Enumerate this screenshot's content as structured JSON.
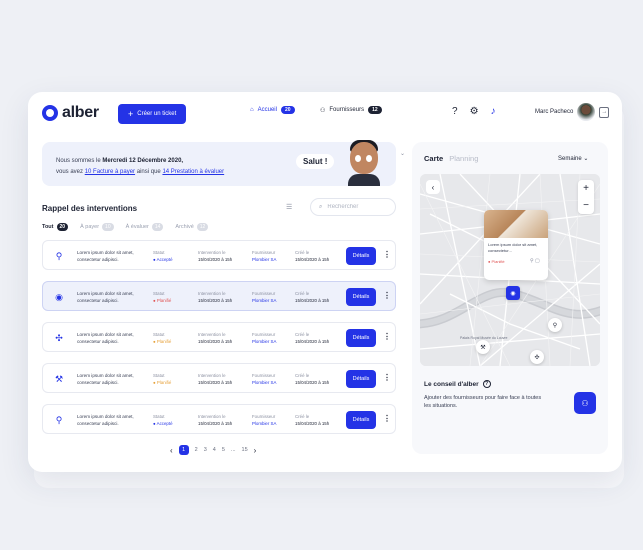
{
  "app": {
    "logo": "alber"
  },
  "header": {
    "create_button": "Créer un ticket",
    "nav": [
      {
        "label": "Accueil",
        "count": "20"
      },
      {
        "label": "Fournisseurs",
        "count": "12"
      }
    ],
    "user_name": "Marc Pacheco"
  },
  "banner": {
    "line1_prefix": "Nous sommes le",
    "date": "Mercredi 12 Décembre 2020,",
    "line2_prefix": "vous avez",
    "invoices_link": "10 Facture à payer",
    "line2_mid": "ainsi que",
    "services_link": "14 Prestation à évaluer",
    "greeting": "Salut !"
  },
  "reminders": {
    "title": "Rappel des interventions",
    "search_placeholder": "Rechercher",
    "filters": [
      {
        "label": "Tout",
        "count": "20"
      },
      {
        "label": "À payer",
        "count": "10"
      },
      {
        "label": "À évaluer",
        "count": "14"
      },
      {
        "label": "Archivé",
        "count": "12"
      }
    ],
    "col_labels": {
      "status": "Statut",
      "intervention": "Intervention le",
      "supplier": "Fournisseur",
      "created": "Créé le"
    },
    "rows": [
      {
        "desc": "Lorem ipsum dolor sit amet, consectetur adipisci.",
        "status": "Accepté",
        "status_color": "#2433e6",
        "date": "15/04/2020 à 15h",
        "supplier": "Plombier SA",
        "created": "15/04/2020 à 15h",
        "icon": "faucet-icon"
      },
      {
        "desc": "Lorem ipsum dolor sit amet, consectetur adipisci.",
        "status": "Planifié",
        "status_color": "#e05555",
        "date": "15/04/2020 à 15h",
        "supplier": "Plombier SA",
        "created": "15/04/2020 à 15h",
        "icon": "paint-icon"
      },
      {
        "desc": "Lorem ipsum dolor sit amet, consectetur adipisci.",
        "status": "Planifié",
        "status_color": "#e6a23c",
        "date": "15/04/2020 à 15h",
        "supplier": "Plombier SA",
        "created": "15/04/2020 à 15h",
        "icon": "fan-icon"
      },
      {
        "desc": "Lorem ipsum dolor sit amet, consectetur adipisci.",
        "status": "Planifié",
        "status_color": "#e6a23c",
        "date": "15/04/2020 à 15h",
        "supplier": "Plombier SA",
        "created": "15/04/2020 à 15h",
        "icon": "wrench-icon"
      },
      {
        "desc": "Lorem ipsum dolor sit amet, consectetur adipisci.",
        "status": "Accepté",
        "status_color": "#2433e6",
        "date": "15/04/2020 à 15h",
        "supplier": "Plombier SA",
        "created": "15/04/2020 à 15h",
        "icon": "faucet-icon"
      }
    ],
    "details_label": "Détails",
    "pagination": [
      "1",
      "2",
      "3",
      "4",
      "5",
      "...",
      "15"
    ]
  },
  "panel": {
    "tab_map": "Carte",
    "tab_planning": "Planning",
    "period": "Semaine",
    "popup_text": "Lorem ipsum dolor sit amet, consectetur...",
    "popup_status": "Planifié",
    "map_place": "Palais Royal Musée du Louvre",
    "tip_title": "Le conseil d'alber",
    "tip_text": "Ajouter des fournisseurs pour faire face à toutes les situations."
  },
  "colors": {
    "accent": "#2433e6",
    "danger": "#e05555",
    "warning": "#e6a23c"
  }
}
